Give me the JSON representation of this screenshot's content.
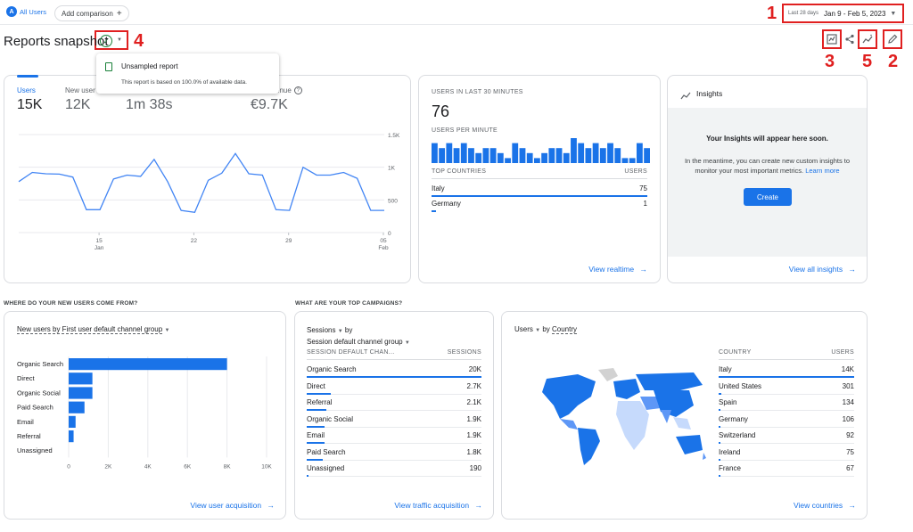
{
  "topbar": {
    "avatar_letter": "A",
    "all_users": "All Users",
    "add_comparison": "Add comparison",
    "date_range_label": "Last 28 days",
    "date_range": "Jan 9 - Feb 5, 2023"
  },
  "header": {
    "title": "Reports snapshot"
  },
  "annotations": [
    "1",
    "2",
    "3",
    "4",
    "5"
  ],
  "popover": {
    "title": "Unsampled report",
    "body": "This report is based on 100.0% of available data."
  },
  "overview": {
    "metrics": [
      {
        "label": "Users",
        "value": "15K"
      },
      {
        "label": "New user",
        "value": "12K"
      },
      {
        "label": "",
        "value": "1m 38s"
      },
      {
        "label": "enue",
        "value": "€9.7K"
      }
    ],
    "y_ticks": [
      "1.5K",
      "1K",
      "500",
      "0"
    ],
    "x_ticks": [
      {
        "day": "15",
        "month": "Jan"
      },
      {
        "day": "22",
        "month": ""
      },
      {
        "day": "29",
        "month": ""
      },
      {
        "day": "05",
        "month": "Feb"
      }
    ]
  },
  "chart_data": {
    "type": "line",
    "title": "",
    "series": [
      {
        "values": [
          780,
          920,
          900,
          895,
          850,
          350,
          350,
          820,
          880,
          860,
          1120,
          780,
          340,
          310,
          800,
          910,
          1210,
          900,
          880,
          350,
          340,
          1000,
          880,
          880,
          920,
          830,
          340,
          340
        ]
      }
    ],
    "ylim": [
      0,
      1500
    ],
    "x_labels": [
      "15 Jan",
      "22",
      "29",
      "05 Feb"
    ]
  },
  "realtime": {
    "title": "USERS IN LAST 30 MINUTES",
    "value": "76",
    "per_minute_label": "USERS PER MINUTE",
    "per_minute_values": [
      4,
      3,
      4,
      3,
      4,
      3,
      2,
      3,
      3,
      2,
      1,
      4,
      3,
      2,
      1,
      2,
      3,
      3,
      2,
      5,
      4,
      3,
      4,
      3,
      4,
      3,
      1,
      1,
      4,
      3
    ],
    "countries_header": "TOP COUNTRIES",
    "users_header": "USERS",
    "rows": [
      {
        "country": "Italy",
        "users": "75",
        "pct": 100
      },
      {
        "country": "Germany",
        "users": "1",
        "pct": 2
      }
    ],
    "link": "View realtime"
  },
  "insights": {
    "title": "Insights",
    "heading": "Your Insights will appear here soon.",
    "body": "In the meantime, you can create new custom insights to monitor your most important metrics.",
    "learn_more": "Learn more",
    "create": "Create",
    "link": "View all insights"
  },
  "acquisition": {
    "section_title": "WHERE DO YOUR NEW USERS COME FROM?",
    "card_title": "New users by First user default channel group",
    "categories": [
      "Organic Search",
      "Direct",
      "Organic Social",
      "Paid Search",
      "Email",
      "Referral",
      "Unassigned"
    ],
    "values": [
      8000,
      1200,
      1200,
      800,
      350,
      250,
      0
    ],
    "x_ticks": [
      "0",
      "2K",
      "4K",
      "6K",
      "8K",
      "10K"
    ],
    "xmax": 10000,
    "link": "View user acquisition"
  },
  "campaigns": {
    "section_title": "WHAT ARE YOUR TOP CAMPAIGNS?",
    "card_title_1": "Sessions",
    "card_title_by": "by",
    "card_title_2": "Session default channel group",
    "col1": "SESSION DEFAULT CHAN...",
    "col2": "SESSIONS",
    "rows": [
      {
        "name": "Organic Search",
        "value": "20K",
        "pct": 100
      },
      {
        "name": "Direct",
        "value": "2.7K",
        "pct": 14
      },
      {
        "name": "Referral",
        "value": "2.1K",
        "pct": 11
      },
      {
        "name": "Organic Social",
        "value": "1.9K",
        "pct": 10
      },
      {
        "name": "Email",
        "value": "1.9K",
        "pct": 10
      },
      {
        "name": "Paid Search",
        "value": "1.8K",
        "pct": 9
      },
      {
        "name": "Unassigned",
        "value": "190",
        "pct": 1
      }
    ],
    "link": "View traffic acquisition"
  },
  "countries": {
    "card_title_1": "Users",
    "card_title_by": "by",
    "card_title_2": "Country",
    "col1": "COUNTRY",
    "col2": "USERS",
    "rows": [
      {
        "name": "Italy",
        "value": "14K",
        "pct": 100
      },
      {
        "name": "United States",
        "value": "301",
        "pct": 2
      },
      {
        "name": "Spain",
        "value": "134",
        "pct": 1
      },
      {
        "name": "Germany",
        "value": "106",
        "pct": 1
      },
      {
        "name": "Switzerland",
        "value": "92",
        "pct": 1
      },
      {
        "name": "Ireland",
        "value": "75",
        "pct": 1
      },
      {
        "name": "France",
        "value": "67",
        "pct": 1
      }
    ],
    "link": "View countries"
  },
  "colors": {
    "accent": "#1a73e8",
    "annotation": "#e02020"
  }
}
